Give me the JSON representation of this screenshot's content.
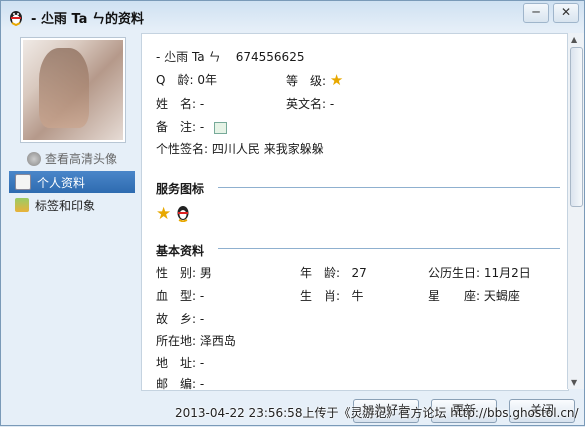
{
  "window": {
    "title": "- 尐雨 Ta ㄣ的资料",
    "buttons": {
      "minimize": "─",
      "close": "✕"
    }
  },
  "sidebar": {
    "hd_avatar_link": "查看高清头像",
    "items": [
      {
        "label": "个人资料",
        "active": true
      },
      {
        "label": "标签和印象",
        "active": false
      }
    ]
  },
  "profile": {
    "nickname": "- 尐雨 Ta ㄣ",
    "qq_number": "674556625",
    "qage_label": "Q　龄:",
    "qage_value": "0年",
    "level_label": "等　级:",
    "name_label": "姓　名:",
    "name_value": "-",
    "en_name_label": "英文名:",
    "en_name_value": "-",
    "remark_label": "备　注:",
    "remark_value": "-",
    "signature_label": "个性签名:",
    "signature_value": "四川人民  来我家躲躲"
  },
  "service_icons": {
    "heading": "服务图标"
  },
  "basic": {
    "heading": "基本资料",
    "rows": [
      [
        {
          "label": "性　别:",
          "value": "男"
        },
        {
          "label": "年　龄:",
          "value": "27"
        },
        {
          "label": "公历生日:",
          "value": "11月2日"
        }
      ],
      [
        {
          "label": "血　型:",
          "value": "-"
        },
        {
          "label": "生　肖:",
          "value": "牛"
        },
        {
          "label": "星　　座:",
          "value": "天蝎座"
        }
      ],
      [
        {
          "label": "故　乡:",
          "value": "-"
        }
      ],
      [
        {
          "label": "所在地:",
          "value": "泽西岛"
        }
      ],
      [
        {
          "label": "地　址:",
          "value": "-"
        }
      ],
      [
        {
          "label": "邮　编:",
          "value": "-"
        }
      ]
    ]
  },
  "footer": {
    "add_friend": "加为好友",
    "refresh": "更新",
    "close": "关闭",
    "watermark": "2013-04-22 23:56:58上传于《灵游记》官方论坛 http://bbs.ghostol.cn/"
  },
  "colors": {
    "accent": "#2e6bb0",
    "section_line": "#8fb0cf"
  }
}
